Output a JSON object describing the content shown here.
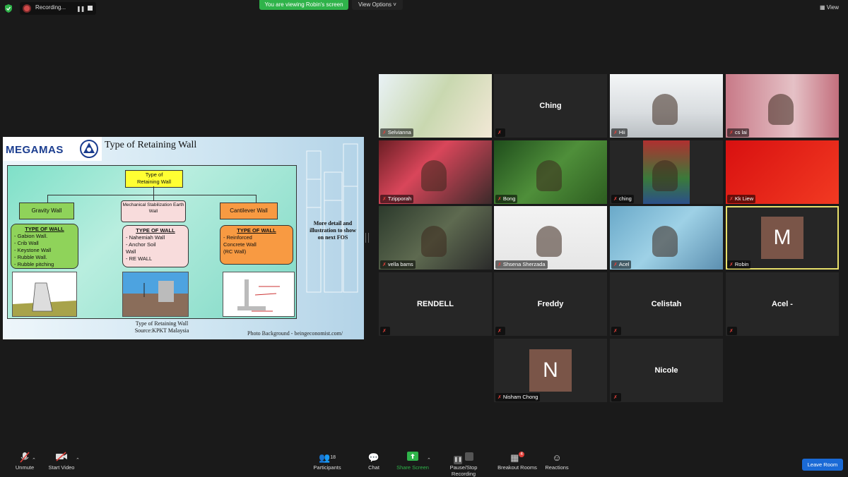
{
  "top_bar": {
    "recording_label": "Recording...",
    "viewing_banner": "You are viewing Robin's screen",
    "view_options": "View Options ˅",
    "view_label": "View"
  },
  "slide": {
    "logo": "MEGAMAS",
    "title": "Type of Retaining Wall",
    "root": "Type of\nRetaining Wall",
    "categories": [
      {
        "label": "Gravity Wall",
        "list_heading": "TYPE OF WALL",
        "items": [
          "-  Gabion Wall.",
          "-  Crib Wall",
          "-  Keystone Wall",
          "-  Rubble Wall.",
          "-  Rubble pitching"
        ]
      },
      {
        "label": "Mechanical Stabilization Earth Wall",
        "list_heading": "TYPE OF WALL",
        "items": [
          "-  Nahemiah Wall",
          "-  Anchor Soil",
          "   Wall",
          "-  RE WALL"
        ]
      },
      {
        "label": "Cantilever Wall",
        "list_heading": "TYPE OF WALL",
        "items": [
          "-  Reinforced",
          "   Concrete Wall",
          "   (RC Wall)"
        ]
      }
    ],
    "side_note": "More detail and illustration to show on next FOS",
    "caption_line1": "Type of Retaining Wall",
    "caption_line2": "Source:KPKT Malaysia",
    "photo_credit": "Photo Background - beingeconomist.com/"
  },
  "participants": [
    {
      "name": "Selvianna",
      "type": "video"
    },
    {
      "name": "Ching",
      "type": "name"
    },
    {
      "name": "Hii",
      "type": "video"
    },
    {
      "name": "cs lai",
      "type": "video"
    },
    {
      "name": "Tzipporah",
      "type": "video"
    },
    {
      "name": "Bong",
      "type": "video"
    },
    {
      "name": "ching",
      "type": "video"
    },
    {
      "name": "Kk Liew",
      "type": "video"
    },
    {
      "name": "vella bams",
      "type": "video"
    },
    {
      "name": "Shsena Sherzada",
      "type": "video"
    },
    {
      "name": "Acel",
      "type": "video"
    },
    {
      "name": "Robin",
      "type": "avatar",
      "initial": "M"
    },
    {
      "name": "RENDELL",
      "type": "name"
    },
    {
      "name": "Freddy",
      "type": "name"
    },
    {
      "name": "Celistah",
      "type": "name"
    },
    {
      "name": "Acel -",
      "type": "name"
    },
    {
      "name": "Nisham Chong",
      "type": "avatar",
      "initial": "N"
    },
    {
      "name": "Nicole",
      "type": "name"
    }
  ],
  "toolbar": {
    "unmute": "Unmute",
    "start_video": "Start Video",
    "participants": "Participants",
    "participants_count": "18",
    "chat": "Chat",
    "share_screen": "Share Screen",
    "record": "Pause/Stop Recording",
    "breakout": "Breakout Rooms",
    "breakout_badge": "4",
    "reactions": "Reactions",
    "leave": "Leave Room"
  },
  "colors": {
    "share_green": "#2fb34a",
    "leave_blue": "#1a6ad6",
    "active_speaker": "#e8e06a",
    "avatar_brown": "#7a5548"
  }
}
